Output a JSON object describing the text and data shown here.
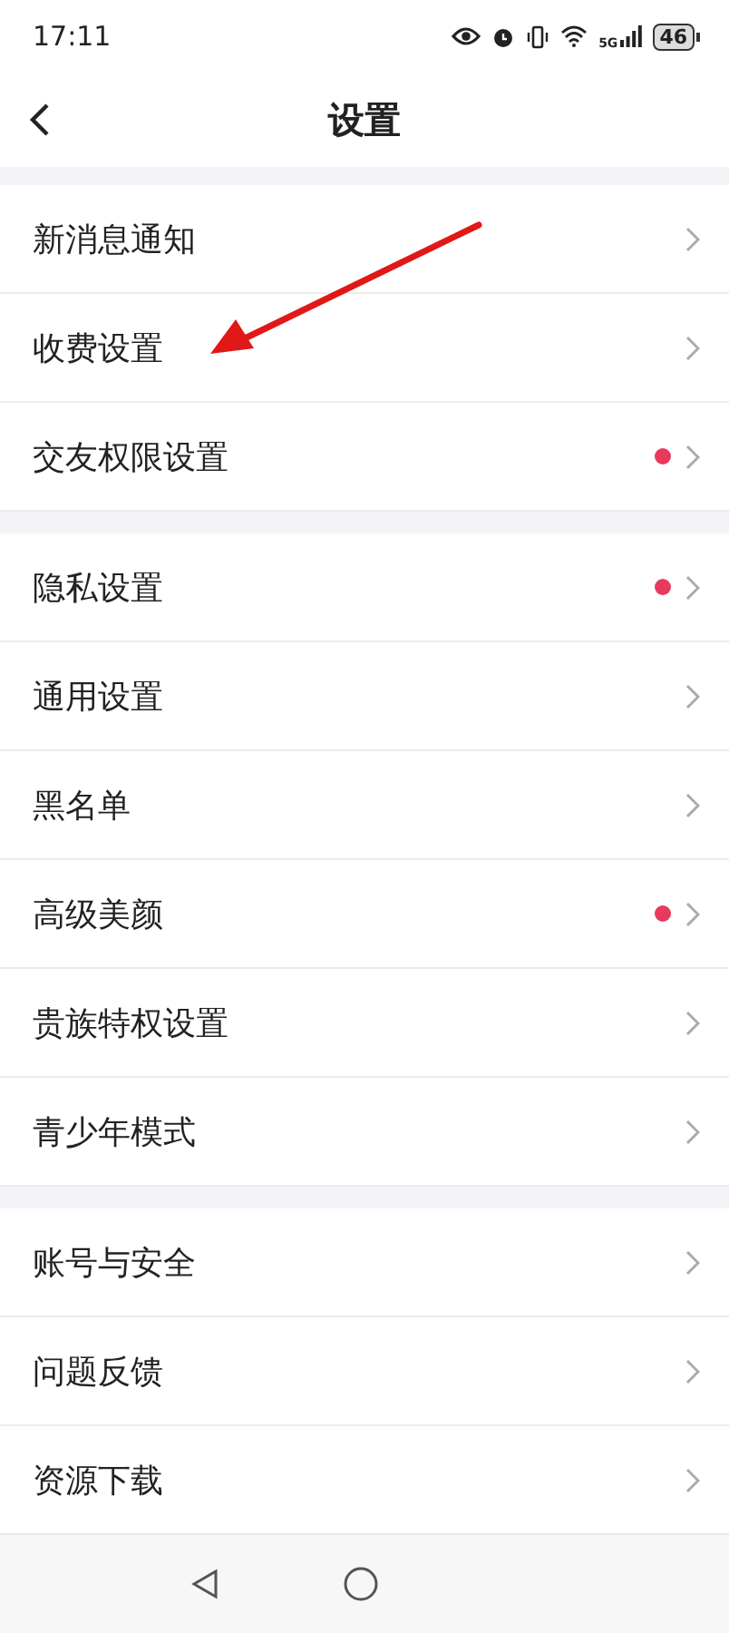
{
  "status_bar": {
    "time": "17:11",
    "network": "5G",
    "battery": "46"
  },
  "header": {
    "title": "设置"
  },
  "groups": [
    {
      "items": [
        {
          "label": "新消息通知",
          "dot": false,
          "pointed": false
        },
        {
          "label": "收费设置",
          "dot": false,
          "pointed": true
        },
        {
          "label": "交友权限设置",
          "dot": true,
          "pointed": false
        }
      ]
    },
    {
      "items": [
        {
          "label": "隐私设置",
          "dot": true,
          "pointed": false
        },
        {
          "label": "通用设置",
          "dot": false,
          "pointed": false
        },
        {
          "label": "黑名单",
          "dot": false,
          "pointed": false
        },
        {
          "label": "高级美颜",
          "dot": true,
          "pointed": false
        },
        {
          "label": "贵族特权设置",
          "dot": false,
          "pointed": false
        },
        {
          "label": "青少年模式",
          "dot": false,
          "pointed": false
        }
      ]
    },
    {
      "items": [
        {
          "label": "账号与安全",
          "dot": false,
          "pointed": false
        },
        {
          "label": "问题反馈",
          "dot": false,
          "pointed": false
        },
        {
          "label": "资源下载",
          "dot": false,
          "pointed": false
        }
      ]
    }
  ]
}
